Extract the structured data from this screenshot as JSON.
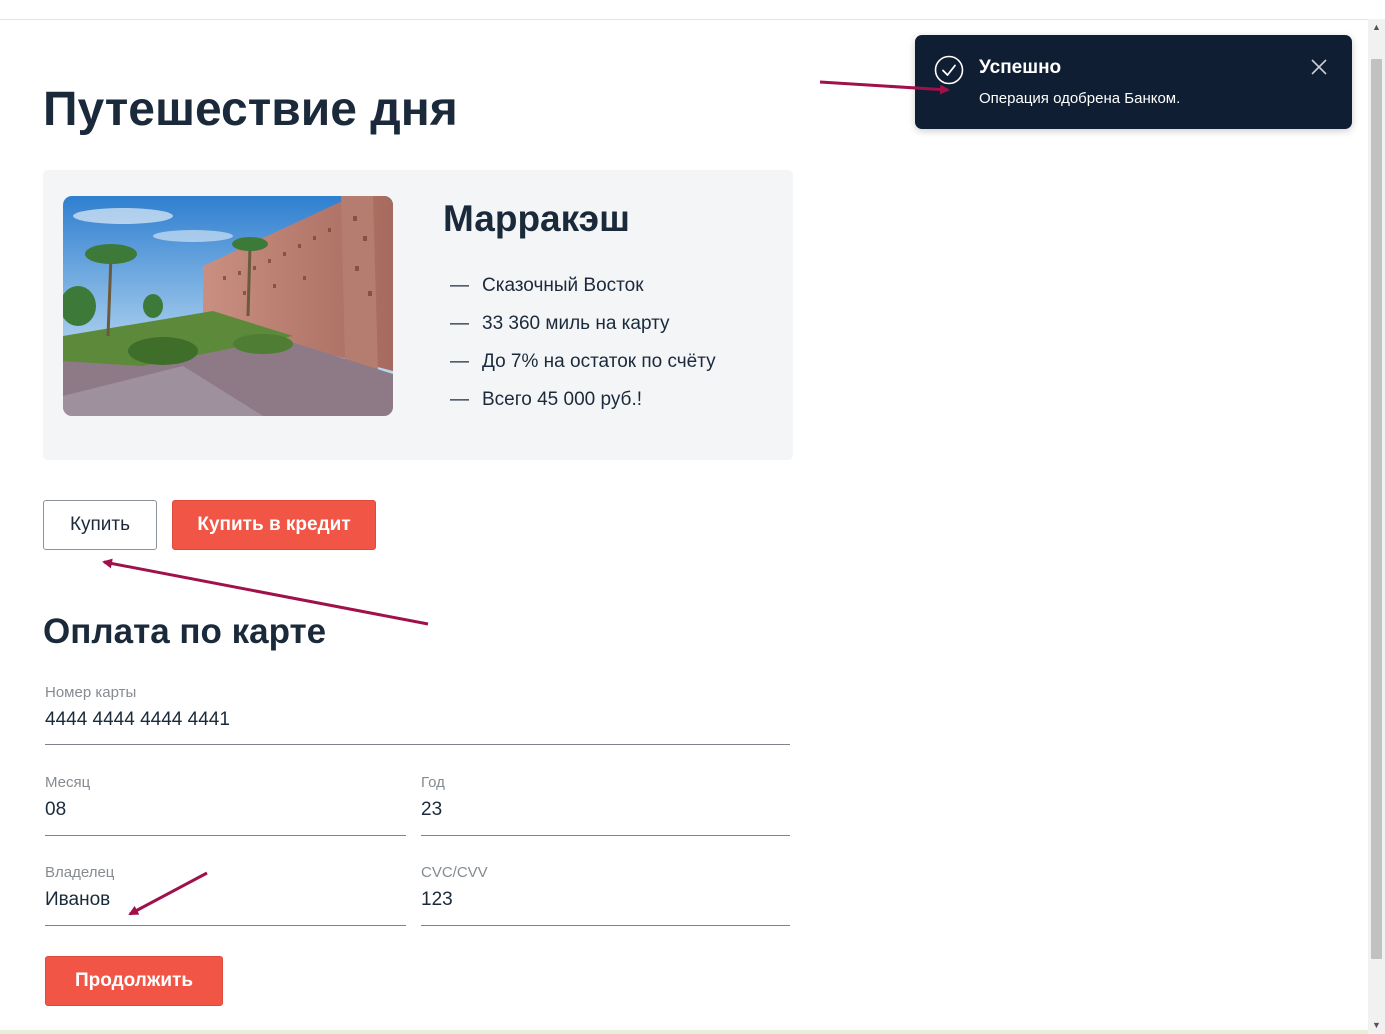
{
  "page": {
    "title": "Путешествие дня"
  },
  "offer": {
    "city": "Марракэш",
    "bullet_symbol": "—",
    "features": [
      "Сказочный Восток",
      "33 360 миль на карту",
      "До 7% на остаток по счёту",
      "Всего 45 000 руб.!"
    ]
  },
  "actions": {
    "buy_label": "Купить",
    "buy_credit_label": "Купить в кредит"
  },
  "payment": {
    "section_title": "Оплата по карте",
    "fields": {
      "card_number": {
        "label": "Номер карты",
        "value": "4444 4444 4444 4441"
      },
      "month": {
        "label": "Месяц",
        "value": "08"
      },
      "year": {
        "label": "Год",
        "value": "23"
      },
      "owner": {
        "label": "Владелец",
        "value": "Иванов"
      },
      "cvc": {
        "label": "CVC/CVV",
        "value": "123"
      }
    },
    "continue_label": "Продолжить"
  },
  "notification": {
    "title": "Успешно",
    "message": "Операция одобрена Банком.",
    "icon": "check-circle-icon",
    "close_icon": "close-icon"
  },
  "colors": {
    "accent": "#f05545",
    "text_dark": "#1b2a3b",
    "toast_bg": "#0f1e32",
    "card_bg": "#f4f5f7",
    "annotation_arrow": "#a0104a"
  }
}
